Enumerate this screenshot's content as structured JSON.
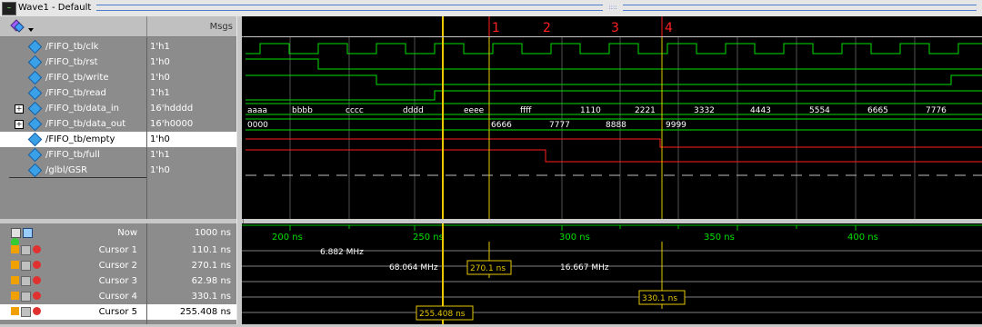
{
  "window": {
    "title": "Wave1 - Default",
    "icon": "wave-window-icon"
  },
  "header": {
    "msgs_label": "Msgs",
    "toolbar_icon": "signal-add-icon"
  },
  "signals": [
    {
      "name": "/FIFO_tb/clk",
      "value": "1'h1",
      "expandable": false,
      "selected": false
    },
    {
      "name": "/FIFO_tb/rst",
      "value": "1'h0",
      "expandable": false,
      "selected": false
    },
    {
      "name": "/FIFO_tb/write",
      "value": "1'h0",
      "expandable": false,
      "selected": false
    },
    {
      "name": "/FIFO_tb/read",
      "value": "1'h1",
      "expandable": false,
      "selected": false
    },
    {
      "name": "/FIFO_tb/data_in",
      "value": "16'hdddd",
      "expandable": true,
      "selected": false
    },
    {
      "name": "/FIFO_tb/data_out",
      "value": "16'h0000",
      "expandable": true,
      "selected": false
    },
    {
      "name": "/FIFO_tb/empty",
      "value": "1'h0",
      "expandable": false,
      "selected": true
    },
    {
      "name": "/FIFO_tb/full",
      "value": "1'h1",
      "expandable": false,
      "selected": false
    },
    {
      "name": "/glbl/GSR",
      "value": "1'h0",
      "expandable": false,
      "selected": false
    }
  ],
  "data_in_values": [
    "aaaa",
    "bbbb",
    "cccc",
    "dddd",
    "eeee",
    "ffff",
    "1110",
    "2221",
    "3332",
    "4443",
    "5554",
    "6665",
    "7776"
  ],
  "data_out_values": [
    "0000",
    "6666",
    "7777",
    "8888",
    "9999"
  ],
  "now": {
    "label": "Now",
    "value": "1000 ns"
  },
  "cursors": [
    {
      "label": "Cursor 1",
      "value": "110.1 ns",
      "selected": false
    },
    {
      "label": "Cursor 2",
      "value": "270.1 ns",
      "selected": false
    },
    {
      "label": "Cursor 3",
      "value": "62.98 ns",
      "selected": false
    },
    {
      "label": "Cursor 4",
      "value": "330.1 ns",
      "selected": false
    },
    {
      "label": "Cursor 5",
      "value": "255.408 ns",
      "selected": true
    }
  ],
  "timescale": {
    "ticks": [
      "200 ns",
      "250 ns",
      "300 ns",
      "350 ns",
      "400 ns"
    ]
  },
  "markers": [
    "1",
    "2",
    "3",
    "4"
  ],
  "cursor_tags": {
    "c2": "270.1 ns",
    "c4": "330.1 ns",
    "c5": "255.408 ns"
  },
  "freq_labels": {
    "f1": "6.882 MHz",
    "f2": "68.064 MHz",
    "f3": "16.667 MHz"
  },
  "colors": {
    "wave": "#00e000",
    "red": "#ff2020",
    "cursor": "#e8c800",
    "active_cursor": "#ffd000",
    "grid": "#505050"
  }
}
